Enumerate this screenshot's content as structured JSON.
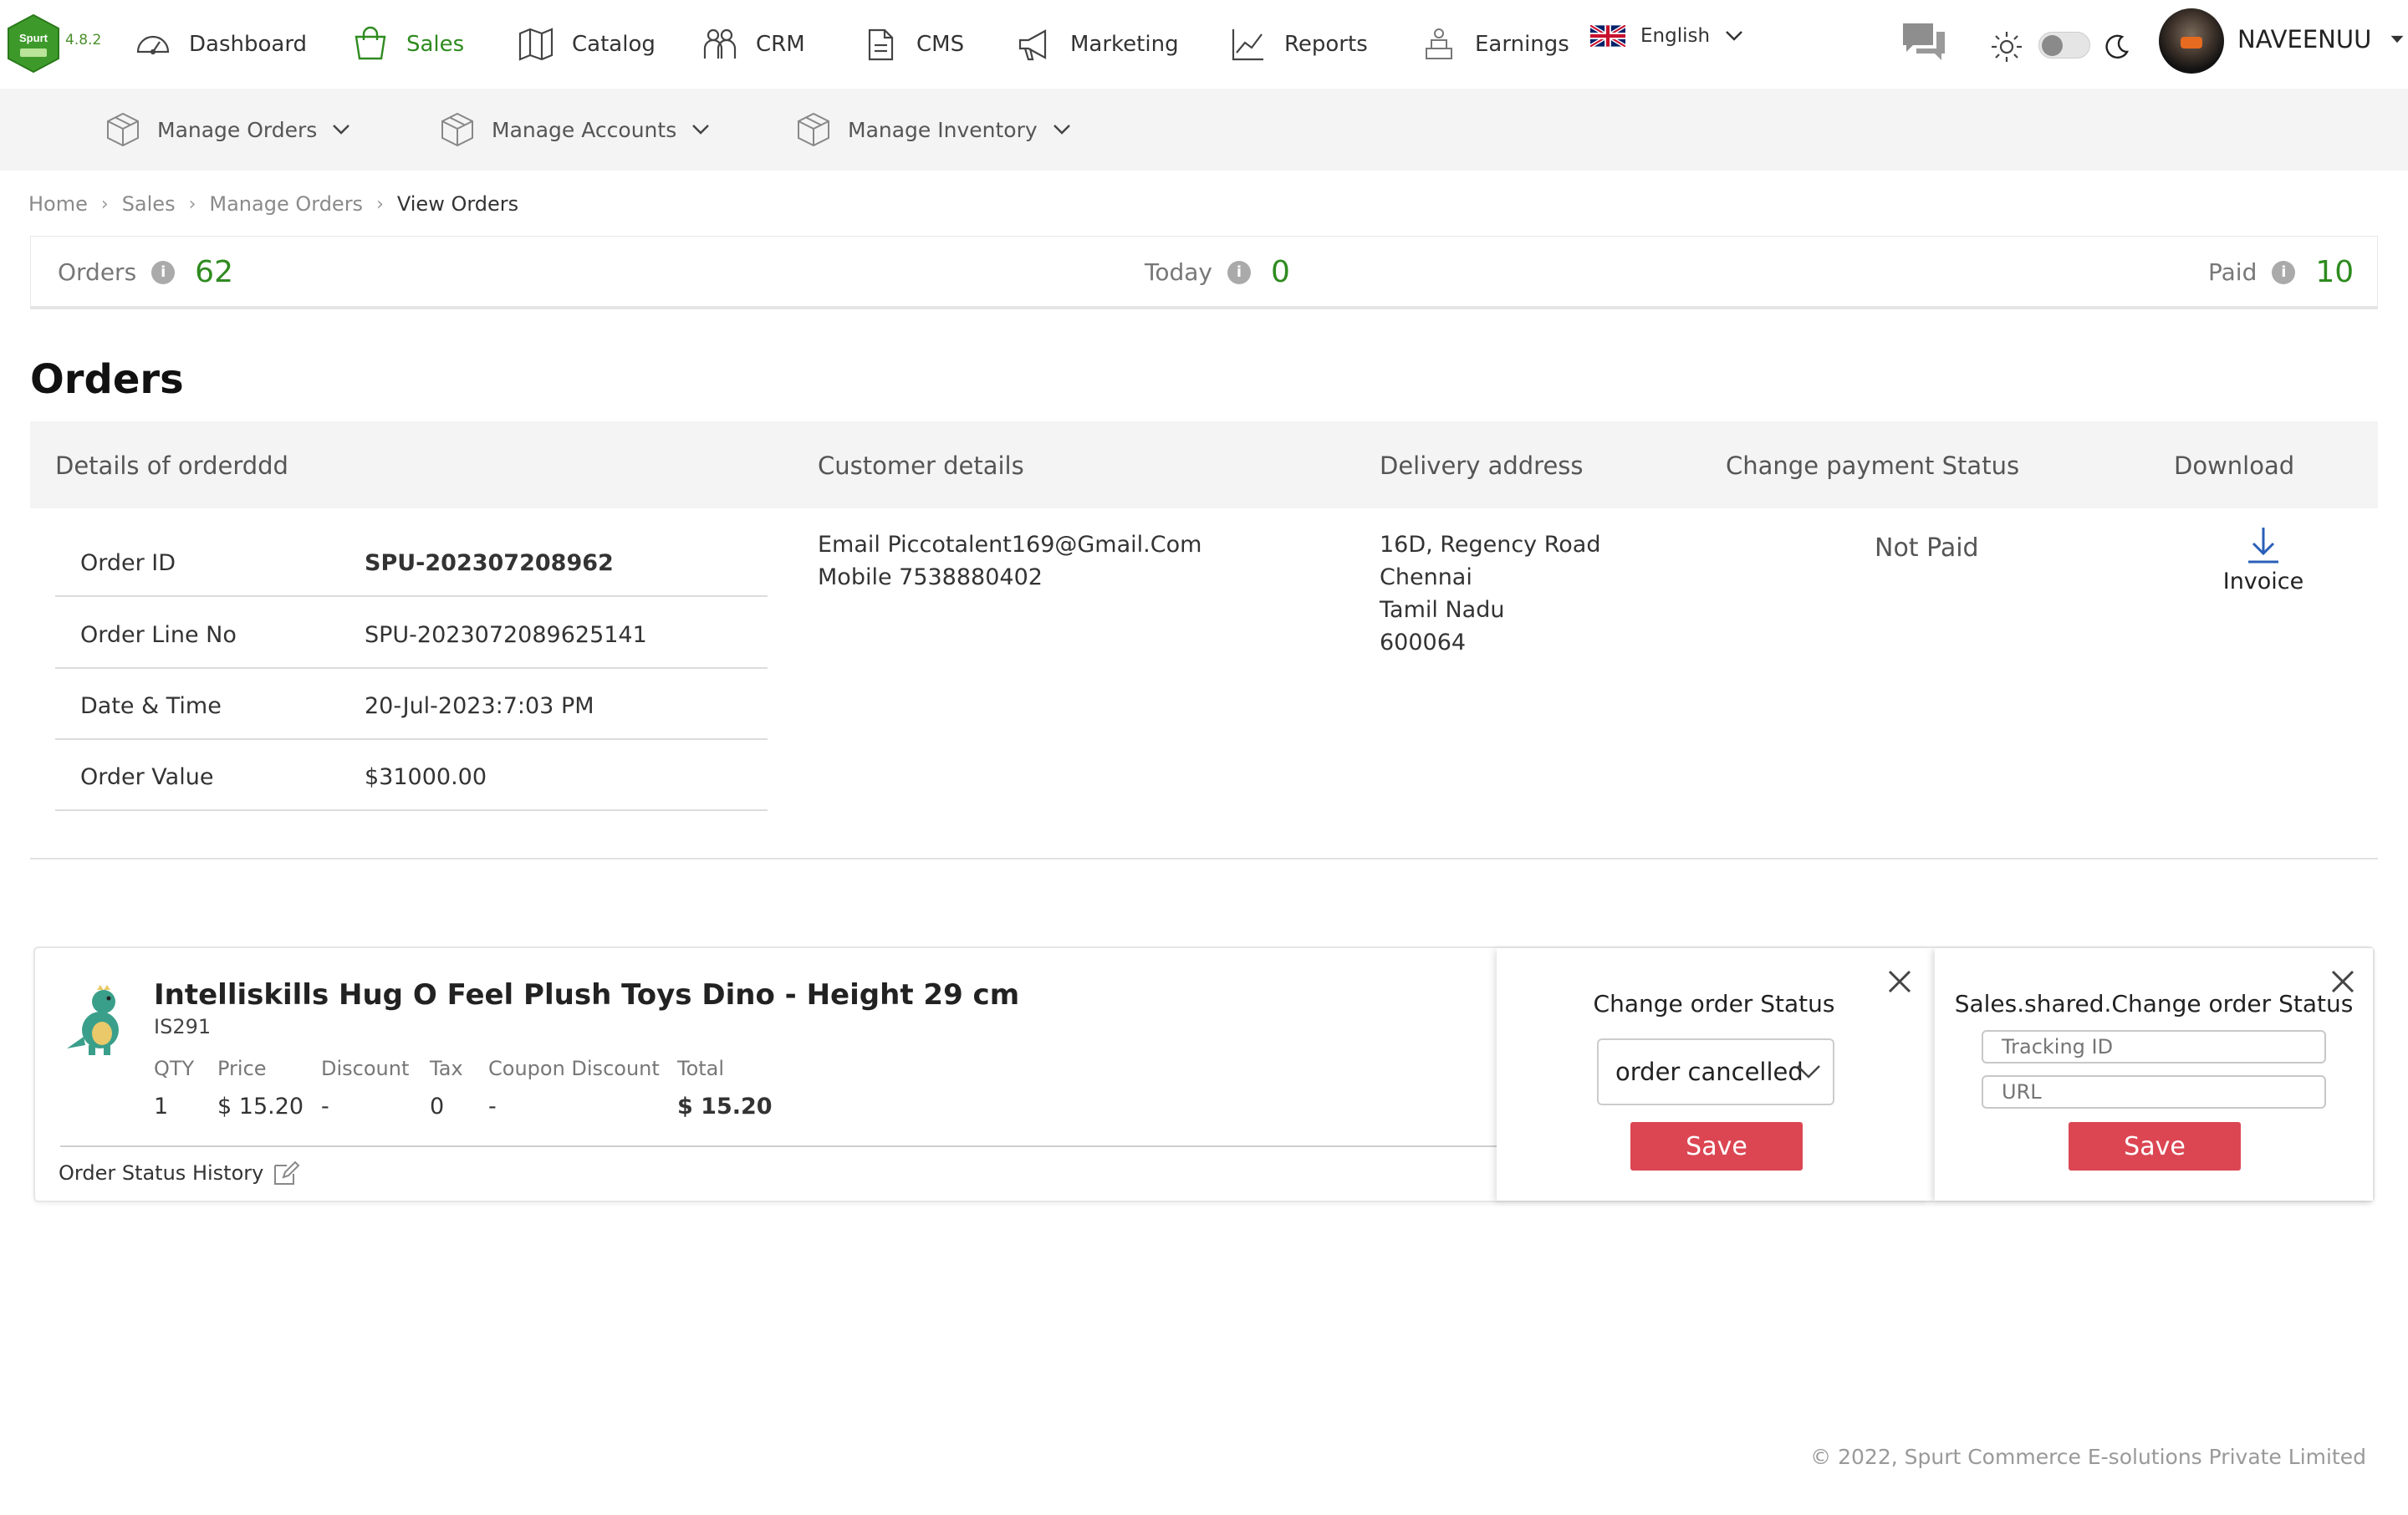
{
  "app": {
    "logo_text": "Spurt",
    "version": "4.8.2"
  },
  "nav": {
    "items": [
      {
        "label": "Dashboard",
        "icon": "gauge-icon"
      },
      {
        "label": "Sales",
        "icon": "shopping-bag-icon",
        "active": true
      },
      {
        "label": "Catalog",
        "icon": "map-icon"
      },
      {
        "label": "CRM",
        "icon": "users-icon"
      },
      {
        "label": "CMS",
        "icon": "document-icon"
      },
      {
        "label": "Marketing",
        "icon": "megaphone-icon"
      },
      {
        "label": "Reports",
        "icon": "trend-chart-icon"
      },
      {
        "label": "Earnings",
        "icon": "earnings-icon"
      }
    ],
    "language": "English",
    "username": "NAVEENUU",
    "accent_color": "#2e8b1f"
  },
  "subnav": {
    "items": [
      {
        "label": "Manage Orders"
      },
      {
        "label": "Manage Accounts"
      },
      {
        "label": "Manage Inventory"
      }
    ]
  },
  "breadcrumb": {
    "items": [
      "Home",
      "Sales",
      "Manage Orders",
      "View Orders"
    ]
  },
  "stats": {
    "orders": {
      "label": "Orders",
      "value": "62"
    },
    "today": {
      "label": "Today",
      "value": "0"
    },
    "paid": {
      "label": "Paid",
      "value": "10"
    }
  },
  "page_title": "Orders",
  "table": {
    "headers": [
      "Details of orderddd",
      "Customer details",
      "Delivery address",
      "Change payment Status",
      "Download"
    ],
    "details": [
      {
        "key": "Order ID",
        "value": "SPU-202307208962"
      },
      {
        "key": "Order Line No",
        "value": "SPU-2023072089625141"
      },
      {
        "key": "Date & Time",
        "value": "20-Jul-2023:7:03 PM"
      },
      {
        "key": "Order Value",
        "value": "$31000.00"
      }
    ],
    "customer": {
      "email": "Email Piccotalent169@Gmail.Com",
      "mobile": "Mobile 7538880402"
    },
    "address": [
      "16D, Regency Road",
      "Chennai",
      "Tamil Nadu",
      "600064"
    ],
    "payment_status": "Not Paid",
    "download_label": "Invoice"
  },
  "product": {
    "name": "Intelliskills Hug O Feel Plush Toys Dino - Height 29 cm",
    "sku": "IS291",
    "columns": [
      {
        "header": "QTY",
        "value": "1"
      },
      {
        "header": "Price",
        "value": "$ 15.20"
      },
      {
        "header": "Discount",
        "value": "-"
      },
      {
        "header": "Tax",
        "value": "0"
      },
      {
        "header": "Coupon Discount",
        "value": "-"
      },
      {
        "header": "Total",
        "value": "$ 15.20"
      }
    ],
    "history_label": "Order Status History"
  },
  "status_panel": {
    "title": "Change order Status",
    "selected": "order cancelled",
    "save_label": "Save"
  },
  "tracking_panel": {
    "title": "Sales.shared.Change order Status",
    "tracking_placeholder": "Tracking ID",
    "url_placeholder": "URL",
    "save_label": "Save"
  },
  "footer": "© 2022, Spurt Commerce E-solutions Private Limited",
  "colors": {
    "save_button": "#dc4653",
    "stat_value": "#2e8b1f"
  }
}
